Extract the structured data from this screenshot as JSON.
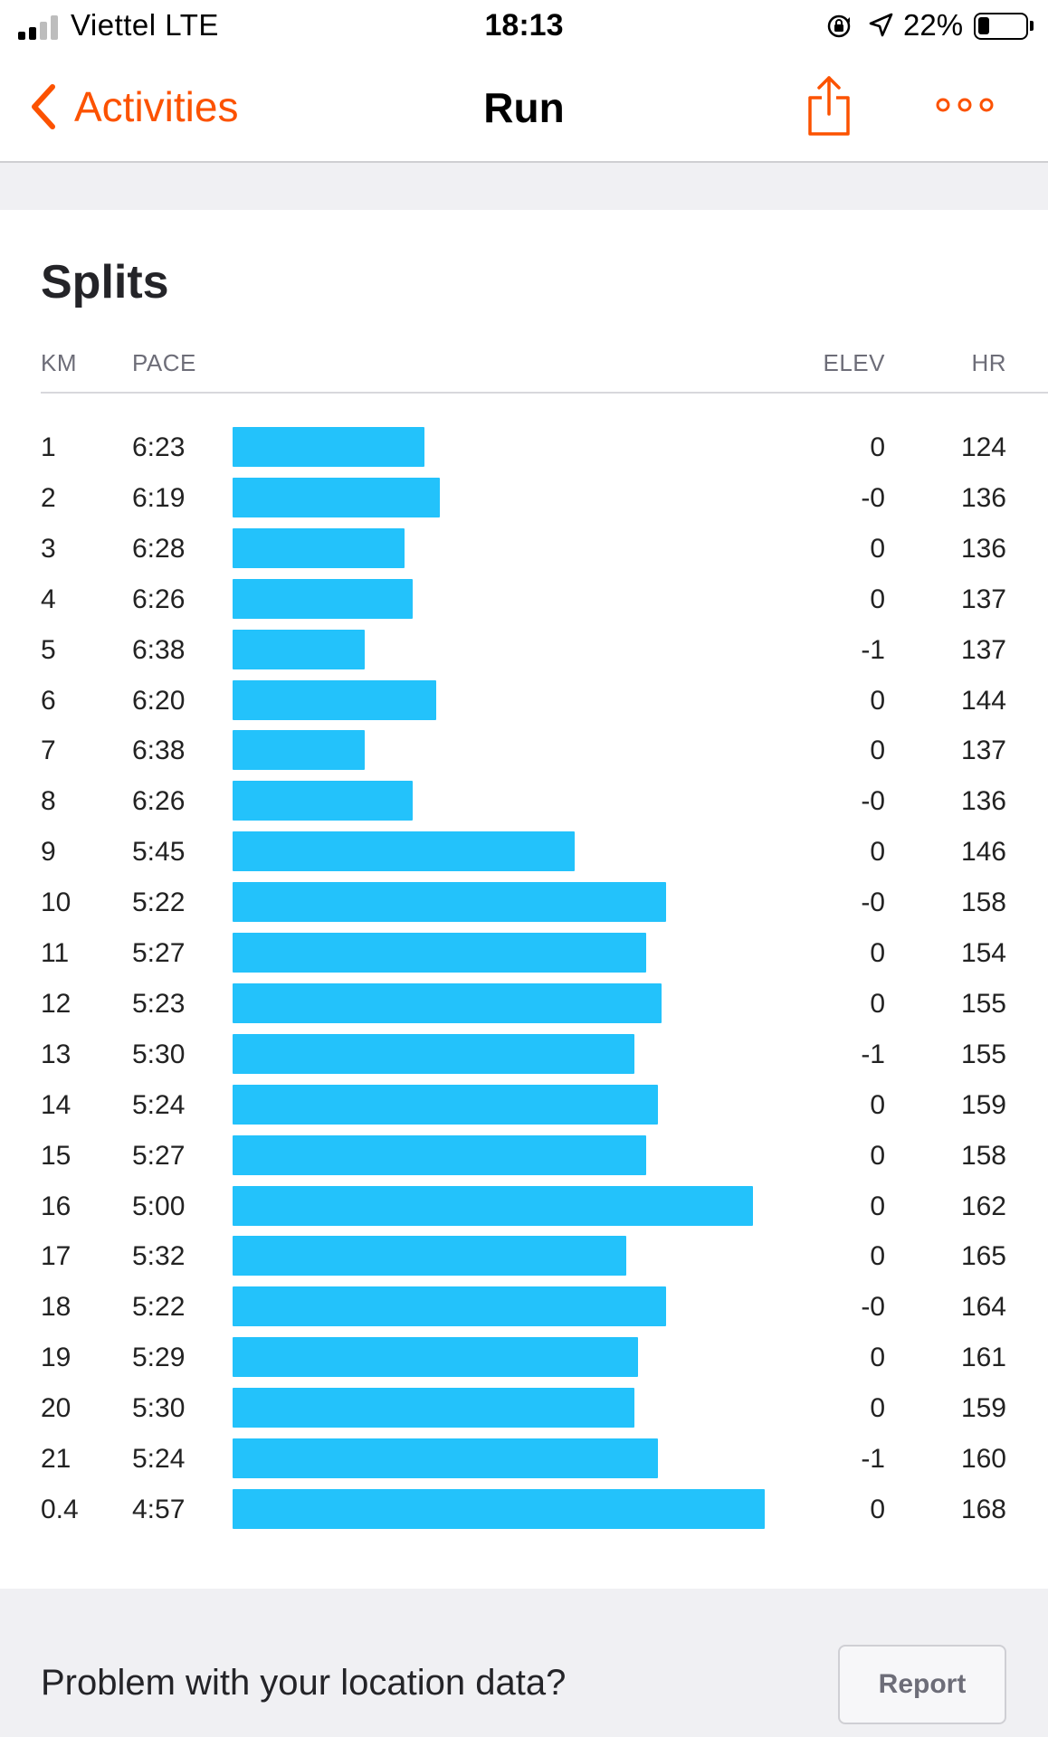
{
  "status_bar": {
    "carrier": "Viettel  LTE",
    "time": "18:13",
    "battery": "22%"
  },
  "nav": {
    "back_label": "Activities",
    "title": "Run",
    "share_icon": "share-icon",
    "more_icon": "more-icon"
  },
  "colors": {
    "accent": "#fc5200",
    "bar": "#23c2fb"
  },
  "splits": {
    "title": "Splits",
    "headers": {
      "km": "KM",
      "pace": "PACE",
      "elev": "ELEV",
      "hr": "HR"
    },
    "rows": [
      {
        "km": "1",
        "pace": "6:23",
        "elev": "0",
        "hr": "124"
      },
      {
        "km": "2",
        "pace": "6:19",
        "elev": "-0",
        "hr": "136"
      },
      {
        "km": "3",
        "pace": "6:28",
        "elev": "0",
        "hr": "136"
      },
      {
        "km": "4",
        "pace": "6:26",
        "elev": "0",
        "hr": "137"
      },
      {
        "km": "5",
        "pace": "6:38",
        "elev": "-1",
        "hr": "137"
      },
      {
        "km": "6",
        "pace": "6:20",
        "elev": "0",
        "hr": "144"
      },
      {
        "km": "7",
        "pace": "6:38",
        "elev": "0",
        "hr": "137"
      },
      {
        "km": "8",
        "pace": "6:26",
        "elev": "-0",
        "hr": "136"
      },
      {
        "km": "9",
        "pace": "5:45",
        "elev": "0",
        "hr": "146"
      },
      {
        "km": "10",
        "pace": "5:22",
        "elev": "-0",
        "hr": "158"
      },
      {
        "km": "11",
        "pace": "5:27",
        "elev": "0",
        "hr": "154"
      },
      {
        "km": "12",
        "pace": "5:23",
        "elev": "0",
        "hr": "155"
      },
      {
        "km": "13",
        "pace": "5:30",
        "elev": "-1",
        "hr": "155"
      },
      {
        "km": "14",
        "pace": "5:24",
        "elev": "0",
        "hr": "159"
      },
      {
        "km": "15",
        "pace": "5:27",
        "elev": "0",
        "hr": "158"
      },
      {
        "km": "16",
        "pace": "5:00",
        "elev": "0",
        "hr": "162"
      },
      {
        "km": "17",
        "pace": "5:32",
        "elev": "0",
        "hr": "165"
      },
      {
        "km": "18",
        "pace": "5:22",
        "elev": "-0",
        "hr": "164"
      },
      {
        "km": "19",
        "pace": "5:29",
        "elev": "0",
        "hr": "161"
      },
      {
        "km": "20",
        "pace": "5:30",
        "elev": "0",
        "hr": "159"
      },
      {
        "km": "21",
        "pace": "5:24",
        "elev": "-1",
        "hr": "160"
      },
      {
        "km": "0.4",
        "pace": "4:57",
        "elev": "0",
        "hr": "168"
      }
    ]
  },
  "problem": {
    "text": "Problem with your location data?",
    "button_label": "Report"
  }
}
